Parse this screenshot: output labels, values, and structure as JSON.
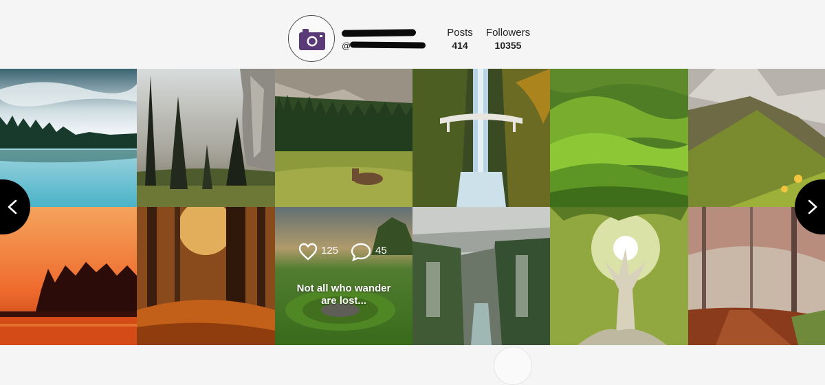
{
  "profile": {
    "handle_prefix": "@",
    "stats": [
      {
        "label": "Posts",
        "value": "414"
      },
      {
        "label": "Followers",
        "value": "10355"
      }
    ],
    "avatar_icon": "camera-icon",
    "avatar_color": "#5b3a78"
  },
  "gallery": {
    "hover_post": {
      "likes": "125",
      "comments": "45",
      "caption_line1": "Not all who wander",
      "caption_line2": "are lost..."
    }
  },
  "navigation": {
    "prev_icon": "chevron-left-icon",
    "next_icon": "chevron-right-icon"
  }
}
